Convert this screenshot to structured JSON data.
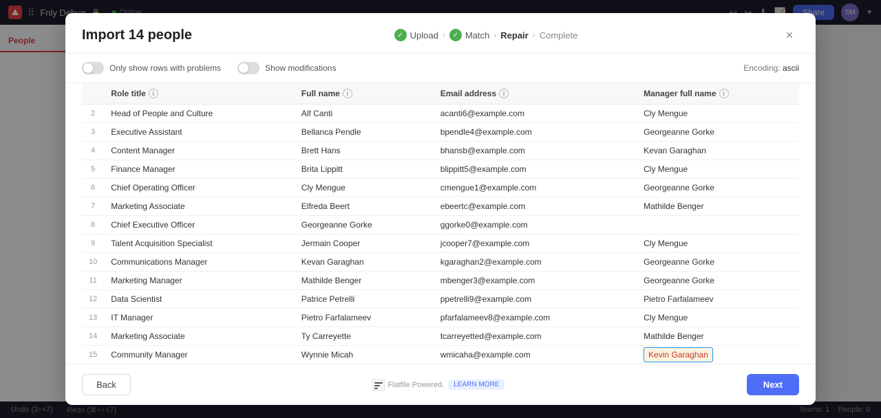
{
  "app": {
    "title": "Fnly Debug",
    "online_label": "Online",
    "share_label": "Share",
    "avatar_initials": "SM"
  },
  "sidebar": {
    "active_item": "People"
  },
  "statusbar": {
    "undo": "Undo (3↑+7)",
    "redo": "Redo (⌘+↑+7)",
    "teams": "Teams: 1",
    "people": "People: 0"
  },
  "modal": {
    "title": "Import 14 people",
    "close_label": "×",
    "steps": [
      {
        "id": "upload",
        "label": "Upload",
        "done": true
      },
      {
        "id": "match",
        "label": "Match",
        "done": true
      },
      {
        "id": "repair",
        "label": "Repair",
        "done": false,
        "active": false
      },
      {
        "id": "complete",
        "label": "Complete",
        "done": false,
        "active": false
      }
    ],
    "toggles": {
      "show_problems_label": "Only show rows with problems",
      "show_modifications_label": "Show modifications"
    },
    "encoding_label": "Encoding:",
    "encoding_value": "ascii",
    "table": {
      "columns": [
        {
          "id": "row_num",
          "label": ""
        },
        {
          "id": "role_title",
          "label": "Role title"
        },
        {
          "id": "full_name",
          "label": "Full name"
        },
        {
          "id": "email_address",
          "label": "Email address"
        },
        {
          "id": "manager_full_name",
          "label": "Manager full name"
        }
      ],
      "rows": [
        {
          "num": "2",
          "role_title": "Head of People and Culture",
          "full_name": "Alf Canti",
          "email_address": "acanti6@example.com",
          "manager_full_name": "Cly Mengue",
          "highlighted": false
        },
        {
          "num": "3",
          "role_title": "Executive Assistant",
          "full_name": "Bellanca Pendle",
          "email_address": "bpendle4@example.com",
          "manager_full_name": "Georgeanne Gorke",
          "highlighted": false
        },
        {
          "num": "4",
          "role_title": "Content Manager",
          "full_name": "Brett Hans",
          "email_address": "bhansb@example.com",
          "manager_full_name": "Kevan Garaghan",
          "highlighted": false
        },
        {
          "num": "5",
          "role_title": "Finance Manager",
          "full_name": "Brita Lippitt",
          "email_address": "blippitt5@example.com",
          "manager_full_name": "Cly Mengue",
          "highlighted": false
        },
        {
          "num": "6",
          "role_title": "Chief Operating Officer",
          "full_name": "Cly Mengue",
          "email_address": "cmengue1@example.com",
          "manager_full_name": "Georgeanne Gorke",
          "highlighted": false
        },
        {
          "num": "7",
          "role_title": "Marketing Associate",
          "full_name": "Elfreda Beert",
          "email_address": "ebeertc@example.com",
          "manager_full_name": "Mathilde Benger",
          "highlighted": false
        },
        {
          "num": "8",
          "role_title": "Chief Executive Officer",
          "full_name": "Georgeanne Gorke",
          "email_address": "ggorke0@example.com",
          "manager_full_name": "",
          "highlighted": false
        },
        {
          "num": "9",
          "role_title": "Talent Acquisition Specialist",
          "full_name": "Jermain Cooper",
          "email_address": "jcooper7@example.com",
          "manager_full_name": "Cly Mengue",
          "highlighted": false
        },
        {
          "num": "10",
          "role_title": "Communications Manager",
          "full_name": "Kevan Garaghan",
          "email_address": "kgaraghan2@example.com",
          "manager_full_name": "Georgeanne Gorke",
          "highlighted": false
        },
        {
          "num": "11",
          "role_title": "Marketing Manager",
          "full_name": "Mathilde Benger",
          "email_address": "mbenger3@example.com",
          "manager_full_name": "Georgeanne Gorke",
          "highlighted": false
        },
        {
          "num": "12",
          "role_title": "Data Scientist",
          "full_name": "Patrice Petrelli",
          "email_address": "ppetrelli9@example.com",
          "manager_full_name": "Pietro Farfalameev",
          "highlighted": false
        },
        {
          "num": "13",
          "role_title": "IT Manager",
          "full_name": "Pietro Farfalameev",
          "email_address": "pfarfalameev8@example.com",
          "manager_full_name": "Cly Mengue",
          "highlighted": false
        },
        {
          "num": "14",
          "role_title": "Marketing Associate",
          "full_name": "Ty Carreyette",
          "email_address": "tcarreyetted@example.com",
          "manager_full_name": "Mathilde Benger",
          "highlighted": false
        },
        {
          "num": "15",
          "role_title": "Community Manager",
          "full_name": "Wynnie Micah",
          "email_address": "wmicaha@example.com",
          "manager_full_name": "Kevin Garaghan",
          "highlighted": true
        }
      ]
    },
    "back_label": "Back",
    "next_label": "Next",
    "powered_by": "Powered.",
    "learn_more": "LEARN MORE"
  }
}
